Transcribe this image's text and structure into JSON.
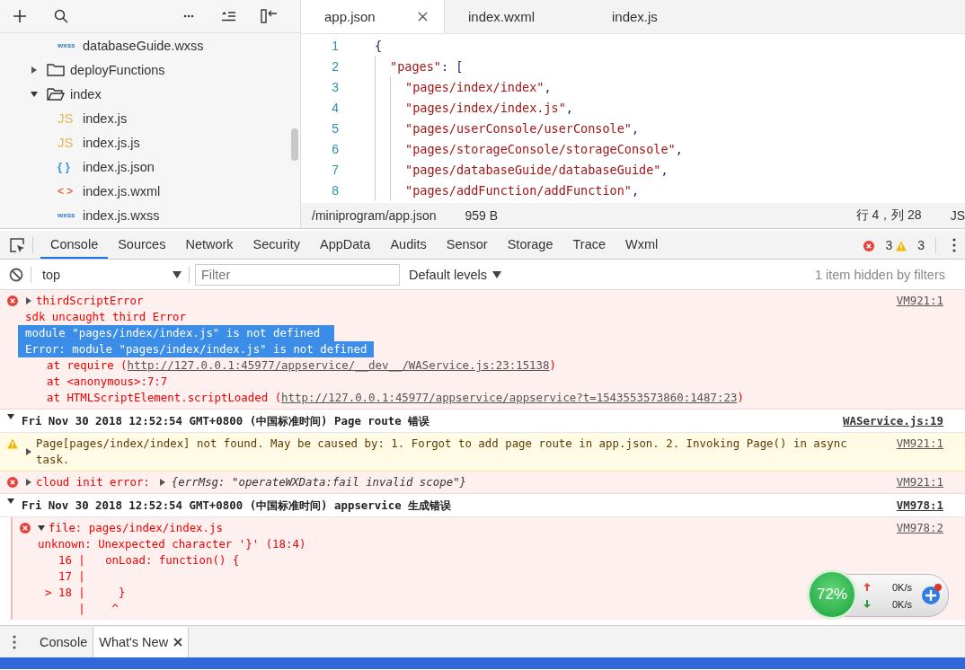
{
  "explorer": {
    "continued": [
      {
        "kind": "wxss",
        "icon": "wxss",
        "name": "databaseGuide.wxss"
      }
    ],
    "items": [
      {
        "kind": "folder",
        "name": "deployFunctions",
        "expanded": false
      },
      {
        "kind": "folder",
        "name": "index",
        "expanded": true,
        "children": [
          {
            "kind": "js",
            "icon": "JS",
            "name": "index.js"
          },
          {
            "kind": "js",
            "icon": "JS",
            "name": "index.js.js"
          },
          {
            "kind": "json",
            "icon": "{ }",
            "name": "index.js.json"
          },
          {
            "kind": "wxml",
            "icon": "< >",
            "name": "index.js.wxml"
          },
          {
            "kind": "wxss",
            "icon": "wxss",
            "name": "index.js.wxss"
          }
        ]
      }
    ]
  },
  "editor": {
    "tabs": [
      {
        "label": "app.json",
        "selected": true
      },
      {
        "label": "index.wxml",
        "selected": false
      },
      {
        "label": "index.js",
        "selected": false
      }
    ],
    "lines": [
      {
        "n": "1",
        "text": "{",
        "children": [
          {
            "n": "2",
            "key": "\"pages\"",
            "text": ": [",
            "children": [
              {
                "n": "3",
                "string": "\"pages/index/index\"",
                "text": ","
              },
              {
                "n": "4",
                "string": "\"pages/index/index.js\"",
                "text": ","
              },
              {
                "n": "5",
                "string": "\"pages/userConsole/userConsole\"",
                "text": ","
              },
              {
                "n": "6",
                "string": "\"pages/storageConsole/storageConsole\"",
                "text": ","
              },
              {
                "n": "7",
                "string": "\"pages/databaseGuide/databaseGuide\"",
                "text": ","
              },
              {
                "n": "8",
                "string": "\"pages/addFunction/addFunction\"",
                "text": ","
              }
            ]
          }
        ]
      }
    ],
    "status": {
      "path": "/miniprogram/app.json",
      "size": "959 B",
      "position": "行 4，列 28",
      "language": "JS"
    }
  },
  "devtools": {
    "tabs": [
      {
        "label": "Console",
        "selected": true
      },
      {
        "label": "Sources",
        "selected": false
      },
      {
        "label": "Network",
        "selected": false
      },
      {
        "label": "Security",
        "selected": false
      },
      {
        "label": "AppData",
        "selected": false
      },
      {
        "label": "Audits",
        "selected": false
      },
      {
        "label": "Sensor",
        "selected": false
      },
      {
        "label": "Storage",
        "selected": false
      },
      {
        "label": "Trace",
        "selected": false
      },
      {
        "label": "Wxml",
        "selected": false
      }
    ],
    "error_count": "3",
    "warning_count": "3",
    "context": "top",
    "filter_placeholder": "Filter",
    "levels": "Default levels",
    "hidden_note": "1 item hidden by filters"
  },
  "console": [
    {
      "kind": "error",
      "expanded": false,
      "title": "thirdScriptError",
      "source": "VM921:1",
      "lines": [
        {
          "kind": "text",
          "text": "sdk uncaught third Error",
          "selected": false
        },
        {
          "kind": "text",
          "text": "module \"pages/index/index.js\" is not defined ",
          "selected": true
        },
        {
          "kind": "text",
          "text": "Error: module \"pages/index/index.js\" is not defined",
          "selected": true
        },
        {
          "kind": "stack",
          "text": "at require (",
          "link": "http://127.0.0.1:45977/appservice/__dev__/WAService.js:23:15138",
          "after": ")"
        },
        {
          "kind": "stack",
          "text": "at <anonymous>:7:7"
        },
        {
          "kind": "stack",
          "text": "at HTMLScriptElement.scriptLoaded (",
          "link": "http://127.0.0.1:45977/appservice/appservice?t=1543553573860:1487:23",
          "after": ")"
        }
      ]
    },
    {
      "kind": "group",
      "expanded": true,
      "title": "Fri Nov 30 2018 12:52:54 GMT+0800 (中国标准时间) Page route 错误",
      "source": "WAService.js:19",
      "children": [
        {
          "kind": "warning",
          "expanded": false,
          "title": "Page[pages/index/index] not found. May be caused by: 1. Forgot to add page route in app.json. 2. Invoking Page() in async task.",
          "source": "VM921:1"
        }
      ]
    },
    {
      "kind": "error",
      "expanded": false,
      "title": "cloud init error: ",
      "object": "{errMsg: \"operateWXData:fail invalid scope\"}",
      "source": "VM921:1"
    },
    {
      "kind": "group",
      "expanded": true,
      "title": "Fri Nov 30 2018 12:52:54 GMT+0800 (中国标准时间)  appservice 生成错误",
      "source": "VM978:1",
      "children": [
        {
          "kind": "error",
          "expanded": true,
          "title": "file: pages/index/index.js",
          "source": "VM978:2",
          "lines": [
            {
              "kind": "text",
              "text": "unknown: Unexpected character '}' (18:4)",
              "selected": false
            },
            {
              "kind": "frame",
              "text": "  16 |   onLoad: function() {"
            },
            {
              "kind": "frame",
              "text": "  17 |"
            },
            {
              "kind": "frame",
              "text": "> 18 |     }"
            },
            {
              "kind": "frame",
              "text": "     |    ^"
            }
          ]
        }
      ]
    }
  ],
  "drawer": {
    "tabs": [
      {
        "label": "Console",
        "selected": false
      },
      {
        "label": "What's New",
        "selected": true
      }
    ]
  },
  "speed_widget": {
    "percent": "72%",
    "upload": "0K/s",
    "download": "0K/s"
  }
}
